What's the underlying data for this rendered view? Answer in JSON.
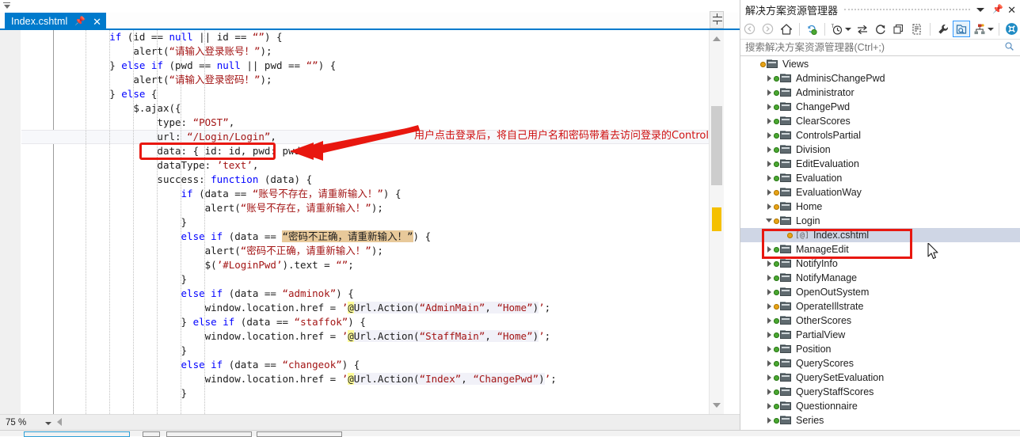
{
  "editor": {
    "tab": {
      "label": "Index.cshtml",
      "pin_icon": "pin-icon",
      "close_icon": "close-icon"
    },
    "zoom_level": "75 %",
    "lines": [
      {
        "indent": 2,
        "tokens": [
          {
            "t": "if",
            "c": "kw"
          },
          {
            "t": " (id "
          },
          {
            "t": "=="
          },
          {
            "t": " "
          },
          {
            "t": "null",
            "c": "kw"
          },
          {
            "t": " || id "
          },
          {
            "t": "== "
          },
          {
            "t": "“”",
            "c": "str"
          },
          {
            "t": ") {"
          }
        ]
      },
      {
        "indent": 3,
        "tokens": [
          {
            "t": "alert("
          },
          {
            "t": "“请输入登录账号！”",
            "c": "str"
          },
          {
            "t": ");"
          }
        ]
      },
      {
        "indent": 2,
        "tokens": [
          {
            "t": "} "
          },
          {
            "t": "else",
            "c": "kw"
          },
          {
            "t": " "
          },
          {
            "t": "if",
            "c": "kw"
          },
          {
            "t": " (pwd == "
          },
          {
            "t": "null",
            "c": "kw"
          },
          {
            "t": " || pwd == "
          },
          {
            "t": "“”",
            "c": "str"
          },
          {
            "t": ") {"
          }
        ]
      },
      {
        "indent": 3,
        "tokens": [
          {
            "t": "alert("
          },
          {
            "t": "“请输入登录密码！”",
            "c": "str"
          },
          {
            "t": ");"
          }
        ]
      },
      {
        "indent": 2,
        "tokens": [
          {
            "t": "} "
          },
          {
            "t": "else",
            "c": "kw"
          },
          {
            "t": " {"
          }
        ]
      },
      {
        "indent": 3,
        "tokens": [
          {
            "t": "$.ajax({"
          }
        ]
      },
      {
        "indent": 4,
        "tokens": [
          {
            "t": "type: "
          },
          {
            "t": "“POST”",
            "c": "str"
          },
          {
            "t": ","
          }
        ]
      },
      {
        "indent": 4,
        "tokens": [
          {
            "t": "url: "
          },
          {
            "t": "“/Login/Login”",
            "c": "str"
          },
          {
            "t": ","
          }
        ]
      },
      {
        "indent": 4,
        "tokens": [
          {
            "t": "data: { id: id, pwd: pwd },"
          }
        ]
      },
      {
        "indent": 4,
        "tokens": [
          {
            "t": "dataType: "
          },
          {
            "t": "’text’",
            "c": "str"
          },
          {
            "t": ","
          }
        ]
      },
      {
        "indent": 4,
        "tokens": [
          {
            "t": "success: "
          },
          {
            "t": "function",
            "c": "kw"
          },
          {
            "t": " (data) {"
          }
        ]
      },
      {
        "indent": 5,
        "tokens": [
          {
            "t": "if",
            "c": "kw"
          },
          {
            "t": " (data == "
          },
          {
            "t": "“账号不存在，请重新输入！”",
            "c": "str"
          },
          {
            "t": ") {"
          }
        ]
      },
      {
        "indent": 6,
        "tokens": [
          {
            "t": "alert("
          },
          {
            "t": "“账号不存在，请重新输入！”",
            "c": "str"
          },
          {
            "t": ");"
          }
        ]
      },
      {
        "indent": 5,
        "tokens": [
          {
            "t": "}"
          }
        ]
      },
      {
        "indent": 5,
        "tokens": [
          {
            "t": "else",
            "c": "kw"
          },
          {
            "t": " "
          },
          {
            "t": "if",
            "c": "kw"
          },
          {
            "t": " (data == "
          },
          {
            "t": "“密码不正确，请重新输入！”",
            "c": "hl-find"
          },
          {
            "t": ") {"
          }
        ]
      },
      {
        "indent": 6,
        "tokens": [
          {
            "t": "alert("
          },
          {
            "t": "“密码不正确，请重新输入！”",
            "c": "str"
          },
          {
            "t": ");"
          }
        ]
      },
      {
        "indent": 6,
        "tokens": [
          {
            "t": "$("
          },
          {
            "t": "’#LoginPwd’",
            "c": "str"
          },
          {
            "t": ").text = "
          },
          {
            "t": "“”",
            "c": "str"
          },
          {
            "t": ";"
          }
        ]
      },
      {
        "indent": 5,
        "tokens": [
          {
            "t": "}"
          }
        ]
      },
      {
        "indent": 5,
        "tokens": [
          {
            "t": "else",
            "c": "kw"
          },
          {
            "t": " "
          },
          {
            "t": "if",
            "c": "kw"
          },
          {
            "t": " (data == "
          },
          {
            "t": "“adminok”",
            "c": "str"
          },
          {
            "t": ") {"
          }
        ]
      },
      {
        "indent": 6,
        "tokens": [
          {
            "t": "window.location.href = "
          },
          {
            "t": "’",
            "c": "str"
          },
          {
            "t": "@",
            "c": "raz"
          },
          {
            "t": "Url.Action(",
            "c": "razbg"
          },
          {
            "t": "“AdminMain”",
            "c": "str razbg"
          },
          {
            "t": ", ",
            "c": "razbg"
          },
          {
            "t": "“Home”",
            "c": "str razbg"
          },
          {
            "t": ")",
            "c": "razbg"
          },
          {
            "t": "’",
            "c": "str"
          },
          {
            "t": ";"
          }
        ]
      },
      {
        "indent": 5,
        "tokens": [
          {
            "t": "} "
          },
          {
            "t": "else",
            "c": "kw"
          },
          {
            "t": " "
          },
          {
            "t": "if",
            "c": "kw"
          },
          {
            "t": " (data == "
          },
          {
            "t": "“staffok”",
            "c": "str"
          },
          {
            "t": ") {"
          }
        ]
      },
      {
        "indent": 6,
        "tokens": [
          {
            "t": "window.location.href = "
          },
          {
            "t": "’",
            "c": "str"
          },
          {
            "t": "@",
            "c": "raz"
          },
          {
            "t": "Url.Action(",
            "c": "razbg"
          },
          {
            "t": "“StaffMain”",
            "c": "str razbg"
          },
          {
            "t": ", ",
            "c": "razbg"
          },
          {
            "t": "“Home”",
            "c": "str razbg"
          },
          {
            "t": ")",
            "c": "razbg"
          },
          {
            "t": "’",
            "c": "str"
          },
          {
            "t": ";"
          }
        ]
      },
      {
        "indent": 5,
        "tokens": [
          {
            "t": "}"
          }
        ]
      },
      {
        "indent": 5,
        "tokens": [
          {
            "t": "else",
            "c": "kw"
          },
          {
            "t": " "
          },
          {
            "t": "if",
            "c": "kw"
          },
          {
            "t": " (data == "
          },
          {
            "t": "“changeok”",
            "c": "str"
          },
          {
            "t": ") {"
          }
        ]
      },
      {
        "indent": 6,
        "tokens": [
          {
            "t": "window.location.href = "
          },
          {
            "t": "’",
            "c": "str"
          },
          {
            "t": "@",
            "c": "raz"
          },
          {
            "t": "Url.Action(",
            "c": "razbg"
          },
          {
            "t": "“Index”",
            "c": "str razbg"
          },
          {
            "t": ", ",
            "c": "razbg"
          },
          {
            "t": "“ChangePwd”",
            "c": "str razbg"
          },
          {
            "t": ")",
            "c": "razbg"
          },
          {
            "t": "’",
            "c": "str"
          },
          {
            "t": ";"
          }
        ]
      },
      {
        "indent": 5,
        "tokens": [
          {
            "t": "}"
          }
        ]
      }
    ],
    "annotation": {
      "text": "用户点击登录后，将自己用户名和密码带着去访问登录的Controller",
      "color": "#cf1111"
    }
  },
  "solution_explorer": {
    "title": "解决方案资源管理器",
    "search_placeholder": "搜索解决方案资源管理器(Ctrl+;)",
    "search_value": "",
    "toolbar": [
      {
        "name": "back-icon",
        "glyph": "←"
      },
      {
        "name": "forward-icon",
        "glyph": "→"
      },
      {
        "name": "home-icon",
        "glyph": "⌂"
      },
      {
        "name": "pending-changes-icon",
        "glyph": "↻"
      },
      {
        "name": "history-icon",
        "glyph": "◴"
      },
      {
        "name": "sync-icon",
        "glyph": "⇄"
      },
      {
        "name": "refresh-icon",
        "glyph": "↻"
      },
      {
        "name": "collapse-all-icon",
        "glyph": "⧉"
      },
      {
        "name": "show-all-files-icon",
        "glyph": "❐"
      },
      {
        "name": "properties-icon",
        "glyph": "ὒ7"
      },
      {
        "name": "preview-selected-items-icon",
        "glyph": "⌕"
      },
      {
        "name": "class-view-icon",
        "glyph": "⑂"
      },
      {
        "name": "team-explorer-icon",
        "glyph": "⊗"
      }
    ],
    "tree": [
      {
        "label": "Views",
        "level": 0,
        "state": "expanded",
        "dot": "orange",
        "icon": "folder-icon",
        "arrow": "none"
      },
      {
        "label": "AdminisChangePwd",
        "level": 1,
        "state": "collapsed",
        "dot": "green",
        "icon": "folder-icon",
        "arrow": "right"
      },
      {
        "label": "Administrator",
        "level": 1,
        "state": "collapsed",
        "dot": "green",
        "icon": "folder-icon",
        "arrow": "right"
      },
      {
        "label": "ChangePwd",
        "level": 1,
        "state": "collapsed",
        "dot": "green",
        "icon": "folder-icon",
        "arrow": "right"
      },
      {
        "label": "ClearScores",
        "level": 1,
        "state": "collapsed",
        "dot": "green",
        "icon": "folder-icon",
        "arrow": "right"
      },
      {
        "label": "ControlsPartial",
        "level": 1,
        "state": "collapsed",
        "dot": "green",
        "icon": "folder-icon",
        "arrow": "right"
      },
      {
        "label": "Division",
        "level": 1,
        "state": "collapsed",
        "dot": "green",
        "icon": "folder-icon",
        "arrow": "right"
      },
      {
        "label": "EditEvaluation",
        "level": 1,
        "state": "collapsed",
        "dot": "green",
        "icon": "folder-icon",
        "arrow": "right"
      },
      {
        "label": "Evaluation",
        "level": 1,
        "state": "collapsed",
        "dot": "green",
        "icon": "folder-icon",
        "arrow": "right"
      },
      {
        "label": "EvaluationWay",
        "level": 1,
        "state": "collapsed",
        "dot": "orange",
        "icon": "folder-icon",
        "arrow": "right"
      },
      {
        "label": "Home",
        "level": 1,
        "state": "collapsed",
        "dot": "orange",
        "icon": "folder-icon",
        "arrow": "right"
      },
      {
        "label": "Login",
        "level": 1,
        "state": "expanded",
        "dot": "orange",
        "icon": "folder-icon",
        "arrow": "down"
      },
      {
        "label": "Index.cshtml",
        "level": 2,
        "state": "leaf",
        "dot": "orange",
        "icon": "razor-file-icon",
        "arrow": "none",
        "selected": true
      },
      {
        "label": "ManageEdit",
        "level": 1,
        "state": "collapsed",
        "dot": "green",
        "icon": "folder-icon",
        "arrow": "right"
      },
      {
        "label": "NotifyInfo",
        "level": 1,
        "state": "collapsed",
        "dot": "green",
        "icon": "folder-icon",
        "arrow": "right"
      },
      {
        "label": "NotifyManage",
        "level": 1,
        "state": "collapsed",
        "dot": "green",
        "icon": "folder-icon",
        "arrow": "right"
      },
      {
        "label": "OpenOutSystem",
        "level": 1,
        "state": "collapsed",
        "dot": "green",
        "icon": "folder-icon",
        "arrow": "right"
      },
      {
        "label": "OperateIllstrate",
        "level": 1,
        "state": "collapsed",
        "dot": "orange",
        "icon": "folder-icon",
        "arrow": "right"
      },
      {
        "label": "OtherScores",
        "level": 1,
        "state": "collapsed",
        "dot": "green",
        "icon": "folder-icon",
        "arrow": "right"
      },
      {
        "label": "PartialView",
        "level": 1,
        "state": "collapsed",
        "dot": "green",
        "icon": "folder-icon",
        "arrow": "right"
      },
      {
        "label": "Position",
        "level": 1,
        "state": "collapsed",
        "dot": "green",
        "icon": "folder-icon",
        "arrow": "right"
      },
      {
        "label": "QueryScores",
        "level": 1,
        "state": "collapsed",
        "dot": "green",
        "icon": "folder-icon",
        "arrow": "right"
      },
      {
        "label": "QuerySetEvaluation",
        "level": 1,
        "state": "collapsed",
        "dot": "green",
        "icon": "folder-icon",
        "arrow": "right"
      },
      {
        "label": "QueryStaffScores",
        "level": 1,
        "state": "collapsed",
        "dot": "green",
        "icon": "folder-icon",
        "arrow": "right"
      },
      {
        "label": "Questionnaire",
        "level": 1,
        "state": "collapsed",
        "dot": "green",
        "icon": "folder-icon",
        "arrow": "right"
      },
      {
        "label": "Series",
        "level": 1,
        "state": "collapsed",
        "dot": "green",
        "icon": "folder-icon",
        "arrow": "right"
      }
    ]
  }
}
